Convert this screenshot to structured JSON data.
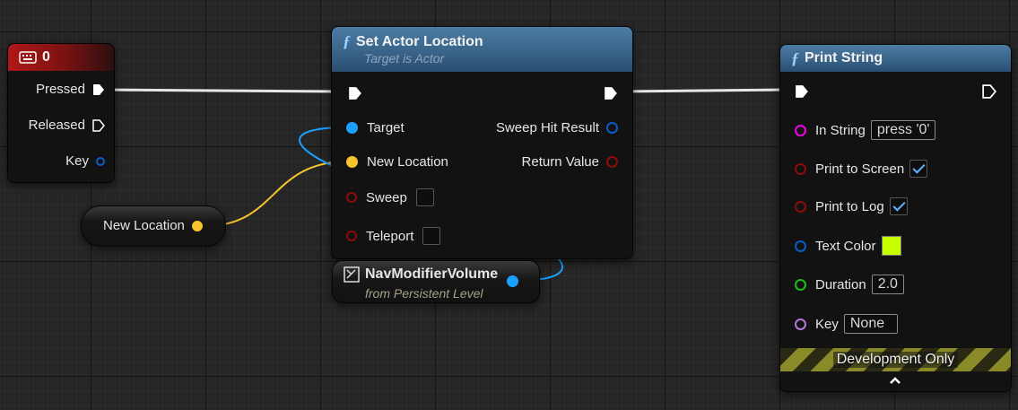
{
  "key_event": {
    "title": "0",
    "icon": "keyboard-icon",
    "pins": {
      "pressed": "Pressed",
      "released": "Released",
      "key": "Key"
    }
  },
  "set_actor_location": {
    "title": "Set Actor Location",
    "subtitle": "Target is Actor",
    "function_glyph": "ƒ",
    "inputs": {
      "target": "Target",
      "new_location": "New Location",
      "sweep": "Sweep",
      "teleport": "Teleport"
    },
    "outputs": {
      "sweep_hit_result": "Sweep Hit Result",
      "return_value": "Return Value"
    },
    "sweep_checked": false,
    "teleport_checked": false
  },
  "new_location_var": {
    "label": "New Location"
  },
  "nav_modifier": {
    "title": "NavModifierVolume",
    "subtitle": "from Persistent Level",
    "icon": "actor-reference-icon"
  },
  "print_string": {
    "title": "Print String",
    "function_glyph": "ƒ",
    "pins": {
      "in_string": "In String",
      "print_to_screen": "Print to Screen",
      "print_to_log": "Print to Log",
      "text_color": "Text Color",
      "duration": "Duration",
      "key": "Key"
    },
    "values": {
      "in_string": "press '0'",
      "duration": "2.0",
      "key": "None"
    },
    "print_to_screen_checked": true,
    "print_to_log_checked": true,
    "text_color_hex": "#c8ff00",
    "footer": "Development Only",
    "expand_icon": "chevron-up-icon"
  },
  "colors": {
    "exec": "#ffffff",
    "object_pin": "#1aa1ff",
    "vector_pin": "#f7c42d",
    "bool_pin": "#8e0b0b",
    "string_pin": "#f000e6",
    "struct_pin": "#0b5cc8",
    "float_pin": "#1bbf1b",
    "key_pin": "#b277d8"
  }
}
